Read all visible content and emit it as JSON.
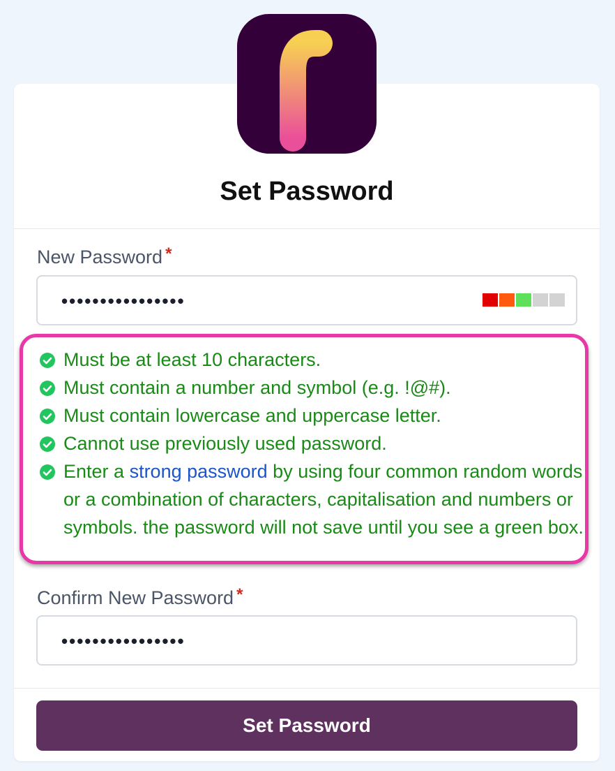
{
  "app": {
    "logo_letter": "F",
    "brand_bg": "#33003a",
    "accent": "#5e315f"
  },
  "page_title": "Set Password",
  "new_password": {
    "label": "New Password",
    "required_mark": "*",
    "value_masked": "••••••••••••••••",
    "strength": {
      "filled_segments": 3,
      "total_segments": 5,
      "colors": [
        "#e00000",
        "#ff5a0f",
        "#5ee05a",
        "#d3d3d3",
        "#d3d3d3"
      ]
    }
  },
  "requirements": [
    {
      "icon": "check-circle-icon",
      "text": "Must be at least 10 characters.",
      "met": true
    },
    {
      "icon": "check-circle-icon",
      "text": "Must contain a number and symbol (e.g. !@#).",
      "met": true
    },
    {
      "icon": "check-circle-icon",
      "text": "Must contain lowercase and uppercase letter.",
      "met": true
    },
    {
      "icon": "check-circle-icon",
      "text": "Cannot use previously used password.",
      "met": true
    },
    {
      "icon": "check-circle-icon",
      "prefix": "Enter a ",
      "link": "strong password",
      "suffix": " by using four common random words or a combination of characters, capitalisation and numbers or symbols. the password will not save until you see a green box.",
      "met": true
    }
  ],
  "confirm_password": {
    "label": "Confirm New Password",
    "required_mark": "*",
    "value_masked": "••••••••••••••••"
  },
  "submit_label": "Set Password",
  "colors": {
    "requirement_text": "#1a8a17",
    "check_icon": "#22c55e",
    "highlight_border": "#e838a8",
    "link": "#1a55c9"
  }
}
